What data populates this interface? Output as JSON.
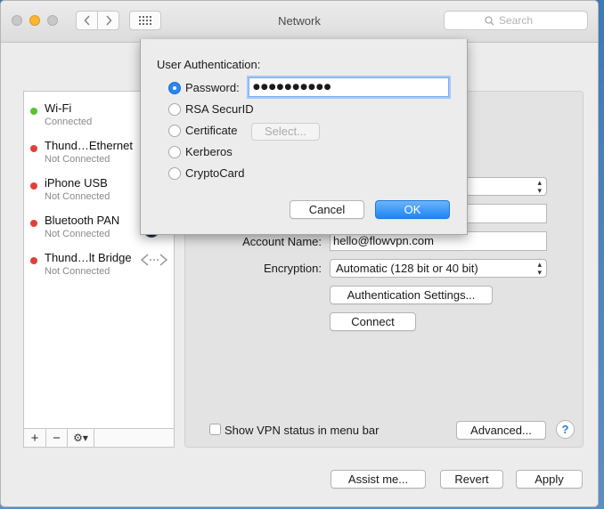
{
  "window": {
    "title": "Network"
  },
  "search": {
    "placeholder": "Search"
  },
  "services": [
    {
      "name": "Wi-Fi",
      "status": "Connected",
      "color": "#5ac134"
    },
    {
      "name": "Thund…Ethernet",
      "status": "Not Connected",
      "color": "#e0403a"
    },
    {
      "name": "iPhone USB",
      "status": "Not Connected",
      "color": "#e0403a"
    },
    {
      "name": "Bluetooth PAN",
      "status": "Not Connected",
      "color": "#e0403a"
    },
    {
      "name": "Thund…lt Bridge",
      "status": "Not Connected",
      "color": "#e0403a"
    }
  ],
  "sidebar_footer": {
    "add": "+",
    "remove": "−",
    "gear": "⚙▾"
  },
  "vpn": {
    "account_label": "Account Name:",
    "account_value": "hello@flowvpn.com",
    "encryption_label": "Encryption:",
    "encryption_value": "Automatic (128 bit or 40 bit)",
    "auth_settings": "Authentication Settings...",
    "connect": "Connect",
    "show_status": "Show VPN status in menu bar",
    "advanced": "Advanced...",
    "help": "?"
  },
  "sheet": {
    "heading": "User Authentication:",
    "options": [
      "Password:",
      "RSA SecurID",
      "Certificate",
      "Kerberos",
      "CryptoCard"
    ],
    "password_value": "●●●●●●●●●●",
    "select_label": "Select...",
    "cancel": "Cancel",
    "ok": "OK"
  },
  "bottom": {
    "assist": "Assist me...",
    "revert": "Revert",
    "apply": "Apply"
  },
  "colors": {
    "accent": "#1e86f4",
    "connected": "#5ac134",
    "disconnected": "#e0403a"
  }
}
